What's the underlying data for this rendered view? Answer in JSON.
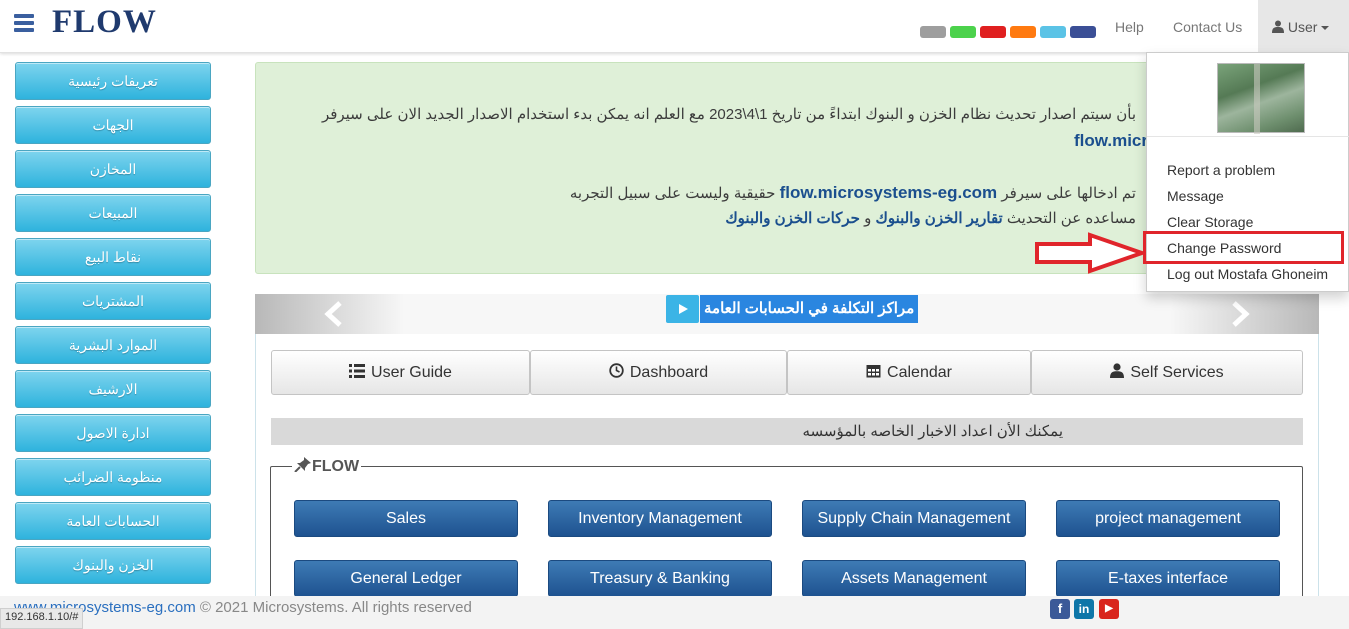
{
  "header": {
    "logo": "FLOW",
    "theme_colors": [
      "#9e9e9e",
      "#4cd24c",
      "#e02020",
      "#ff7a10",
      "#5bc3e6",
      "#3b4f96"
    ],
    "help_label": "Help",
    "contact_label": "Contact Us",
    "user_label": "User"
  },
  "user_menu": {
    "items": [
      "Report a problem",
      "Message",
      "Clear Storage",
      "Change Password",
      "Log out Mostafa Ghoneim"
    ],
    "highlighted": "Change Password"
  },
  "sidebar": {
    "items": [
      "تعريفات رئيسية",
      "الجهات",
      "المخازن",
      "المبيعات",
      "نقاط البيع",
      "المشتريات",
      "الموارد البشرية",
      "الارشيف",
      "ادارة الاصول",
      "منظومة الضرائب",
      "الحسابات العامة",
      "الخزن والبنوك"
    ]
  },
  "alert": {
    "line1": "بأن سيتم اصدار تحديث نظام الخزن و البنوك ابتداءً من تاريخ 1\\4\\2023 مع العلم انه يمكن بدء استخدام الاصدار الجديد الان على سيرفر",
    "link1": "flow.micr",
    "line2_pre": "تم ادخالها على سيرفر",
    "link2": "flow.microsystems-eg.com",
    "line2_post": "حقيقية وليست على سبيل التجربه",
    "line3_pre": "مساعده عن التحديث",
    "link3a": "تقارير الخزن والبنوك",
    "line3_mid": "و",
    "link3b": "حركات الخزن والبنوك"
  },
  "carousel": {
    "caption": "مراكز التكلفة في الحسابات العامة"
  },
  "tabs": {
    "user_guide": "User Guide",
    "dashboard": "Dashboard",
    "calendar": "Calendar",
    "self_services": "Self Services"
  },
  "news": {
    "text": "يمكنك الأن اعداد الاخبار الخاصه بالمؤسسه"
  },
  "modules": {
    "legend": "FLOW",
    "items": [
      "Sales",
      "Inventory Management",
      "Supply Chain Management",
      "project management",
      "General Ledger",
      "Treasury & Banking",
      "Assets Management",
      "E-taxes interface"
    ]
  },
  "footer": {
    "site": "www.microsystems-eg.com",
    "copyright": " © 2021 Microsystems. All rights reserved",
    "status_url": "192.168.1.10/#"
  }
}
